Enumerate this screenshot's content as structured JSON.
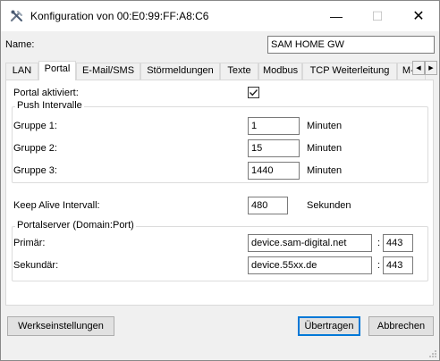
{
  "window": {
    "title": "Konfiguration von 00:E0:99:FF:A8:C6",
    "minimize": "—",
    "maximize": "☐",
    "close": "✕"
  },
  "name": {
    "label": "Name:",
    "value": "SAM HOME GW"
  },
  "tabs": [
    {
      "label": "LAN"
    },
    {
      "label": "Portal"
    },
    {
      "label": "E-Mail/SMS"
    },
    {
      "label": "Störmeldungen"
    },
    {
      "label": "Texte"
    },
    {
      "label": "Modbus"
    },
    {
      "label": "TCP Weiterleitung"
    },
    {
      "label": "M-E"
    }
  ],
  "tab_scroll": {
    "left": "◀",
    "right": "▶"
  },
  "portal": {
    "enabled_label": "Portal aktiviert:",
    "enabled_checked": true,
    "push": {
      "legend": "Push Intervalle",
      "groups": [
        {
          "label": "Gruppe 1:",
          "value": "1",
          "unit": "Minuten"
        },
        {
          "label": "Gruppe 2:",
          "value": "15",
          "unit": "Minuten"
        },
        {
          "label": "Gruppe 3:",
          "value": "1440",
          "unit": "Minuten"
        }
      ]
    },
    "keepalive": {
      "label": "Keep Alive Intervall:",
      "value": "480",
      "unit": "Sekunden"
    },
    "server": {
      "legend": "Portalserver (Domain:Port)",
      "primary": {
        "label": "Primär:",
        "domain": "device.sam-digital.net",
        "sep": ":",
        "port": "443"
      },
      "secondary": {
        "label": "Sekundär:",
        "domain": "device.55xx.de",
        "sep": ":",
        "port": "443"
      }
    }
  },
  "buttons": {
    "factory": "Werkseinstellungen",
    "transfer": "Übertragen",
    "cancel": "Abbrechen"
  }
}
